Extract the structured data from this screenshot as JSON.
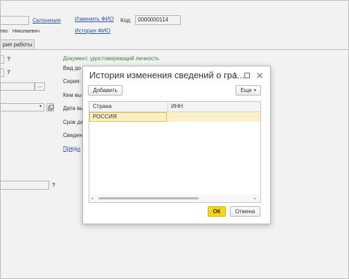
{
  "background": {
    "top_suffix": "тво:",
    "patronymic": "Николаевич",
    "declension_link": "Склонения",
    "change_name_link": "Изменить ФИО",
    "name_history_link": "История ФИО",
    "code_label": "Код:",
    "code_value": "0000000114",
    "tab_label": "рия работы",
    "id_doc_title": "Документ, удостоверяющий личность",
    "doc_type_label": "Вид до",
    "series_label": "Серия:",
    "issued_by_label": "Кем вы",
    "issue_date_label": "Дата вы",
    "validity_label": "Срок де",
    "info_label": "Сведен",
    "prev_link": "Преды",
    "help_mark": "?",
    "ellipsis": "..."
  },
  "dialog": {
    "title": "История изменения сведений о гра...",
    "add_button": "Добавить",
    "more_button": "Еще",
    "columns": [
      "Страна",
      "ИНН"
    ],
    "rows": [
      {
        "country": "РОССИЯ",
        "inn": ""
      }
    ],
    "ok_button": "ОК",
    "cancel_button": "Отмена"
  },
  "colors": {
    "link": "#2a5aa8",
    "selected_row": "#fbefc5",
    "ok_button": "#f8d616",
    "section_title": "#3b8a3b"
  }
}
